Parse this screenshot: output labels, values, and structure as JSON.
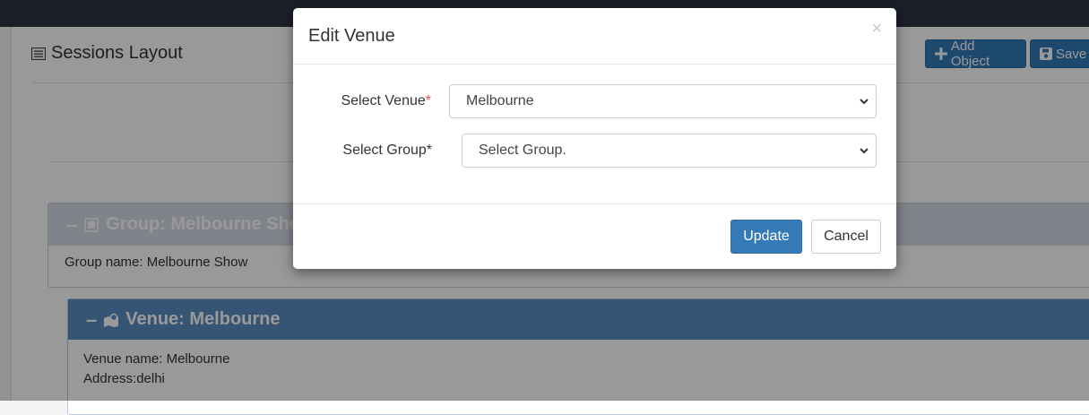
{
  "page": {
    "title": "Sessions Layout",
    "add_object_label": "Add Object",
    "save_label": "Save"
  },
  "group_panel": {
    "header": "Group: Melbourne Show",
    "name_line": "Group name: Melbourne Show"
  },
  "venue_panel": {
    "header": "Venue: Melbourne",
    "name_line": "Venue name: Melbourne",
    "address_line": "Address:delhi"
  },
  "modal": {
    "title": "Edit Venue",
    "close_glyph": "×",
    "venue_label": "Select Venue",
    "venue_value": "Melbourne",
    "group_label": "Select Group*",
    "group_value": "Select Group.",
    "required_mark": "*",
    "update_label": "Update",
    "cancel_label": "Cancel"
  },
  "colors": {
    "primary": "#337ab7",
    "required": "#d9534f",
    "topbar": "#2e3541"
  }
}
